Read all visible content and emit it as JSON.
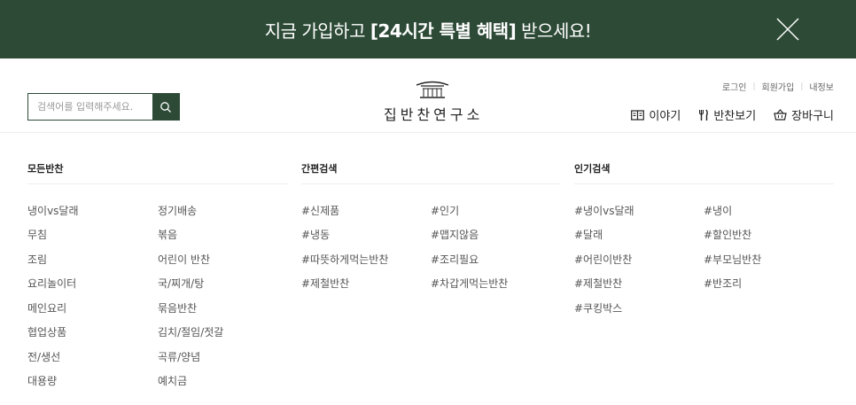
{
  "banner": {
    "text_before": "지금 가입하고 ",
    "text_bold": "[24시간 특별 혜택]",
    "text_after": " 받으세요!",
    "close_icon": "close-icon",
    "background": "#2d4a36"
  },
  "search": {
    "placeholder": "검색어를 입력해주세요.",
    "icon": "search-icon"
  },
  "logo": {
    "text": "집반찬연구소",
    "icon": "hanok-roof-icon"
  },
  "util_links": [
    "로그인",
    "회원가입",
    "내정보"
  ],
  "main_nav": [
    {
      "label": "이야기",
      "icon": "book-icon"
    },
    {
      "label": "반찬보기",
      "icon": "utensils-icon"
    },
    {
      "label": "장바구니",
      "icon": "basket-icon"
    }
  ],
  "menu": {
    "all": {
      "title": "모든반찬",
      "left": [
        "냉이vs달래",
        "무침",
        "조림",
        "요리놀이터",
        "메인요리",
        "협업상품",
        "전/생선",
        "대용량"
      ],
      "right": [
        "정기배송",
        "볶음",
        "어린이 반찬",
        "국/찌개/탕",
        "묶음반찬",
        "김치/절임/젓갈",
        "곡류/양념",
        "예치금"
      ]
    },
    "quick": {
      "title": "간편검색",
      "left": [
        "#신제품",
        "#냉동",
        "#따뜻하게먹는반찬",
        "#제철반찬"
      ],
      "right": [
        "#인기",
        "#맵지않음",
        "#조리필요",
        "#차갑게먹는반찬"
      ]
    },
    "popular": {
      "title": "인기검색",
      "left": [
        "#냉이vs달래",
        "#달래",
        "#어린이반찬",
        "#제철반찬",
        "#쿠킹박스"
      ],
      "right": [
        "#냉이",
        "#할인반찬",
        "#부모님반찬",
        "#반조리"
      ]
    }
  }
}
